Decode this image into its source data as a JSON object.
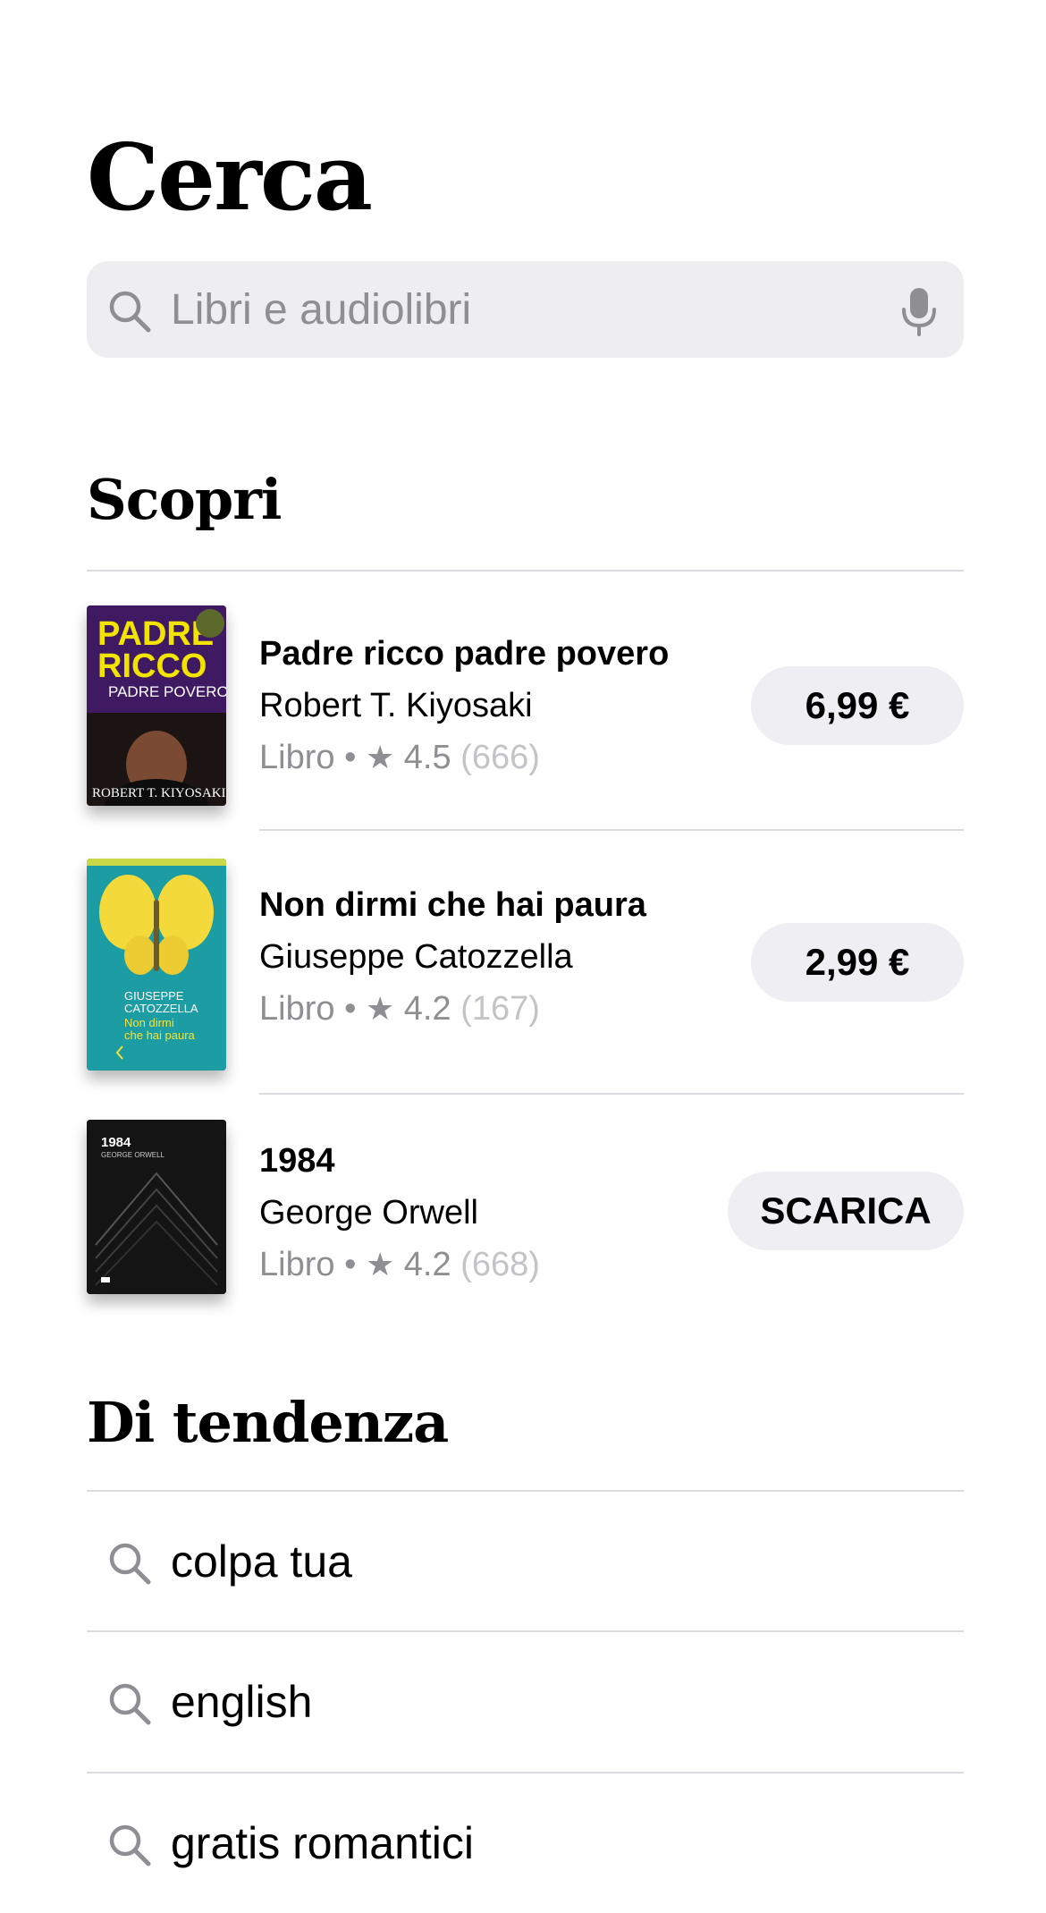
{
  "header": {
    "title": "Cerca"
  },
  "search": {
    "placeholder": "Libri e audiolibri",
    "value": ""
  },
  "discover": {
    "title": "Scopri",
    "books": [
      {
        "title": "Padre ricco padre povero",
        "author": "Robert T. Kiyosaki",
        "type": "Libro",
        "rating": "4.5",
        "count": "(666)",
        "action": "6,99 €",
        "cover": {
          "line1": "PADRE",
          "line2": "RICCO",
          "line3": "PADRE POVERO",
          "author": "ROBERT T. KIYOSAKI"
        }
      },
      {
        "title": "Non dirmi che hai paura",
        "author": "Giuseppe Catozzella",
        "type": "Libro",
        "rating": "4.2",
        "count": "(167)",
        "action": "2,99 €",
        "cover": {
          "author1": "GIUSEPPE",
          "author2": "CATOZZELLA",
          "title1": "Non dirmi",
          "title2": "che hai paura"
        }
      },
      {
        "title": "1984",
        "author": "George Orwell",
        "type": "Libro",
        "rating": "4.2",
        "count": "(668)",
        "action": "SCARICA",
        "cover": {
          "title": "1984",
          "author": "GEORGE ORWELL"
        }
      }
    ]
  },
  "trending": {
    "title": "Di tendenza",
    "items": [
      {
        "label": "colpa tua"
      },
      {
        "label": "english"
      },
      {
        "label": "gratis romantici"
      }
    ]
  },
  "colors": {
    "search_bg": "#eeeef0",
    "button_bg": "#eeeef3",
    "secondary_text": "#8e8e93",
    "tertiary_text": "#c3c3c8",
    "divider": "#dcdce0"
  }
}
